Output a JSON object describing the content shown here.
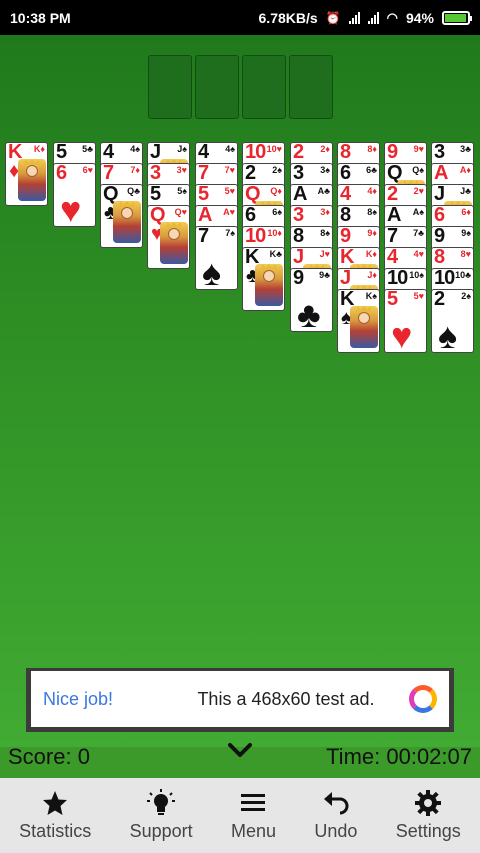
{
  "status_bar": {
    "time": "10:38 PM",
    "network_speed": "6.78KB/s",
    "battery_percent": "94%",
    "battery_level": 0.94,
    "icons": [
      "alarm-off-icon",
      "signal-icon",
      "signal-icon",
      "wifi-icon",
      "battery-charging-icon"
    ]
  },
  "colors": {
    "felt_top": "#207a1c",
    "felt_bottom": "#41ab33",
    "red_suit": "#e8262d",
    "black_suit": "#111111",
    "nav_bg": "#e6e6e6"
  },
  "foundations": [
    {
      "slot": "foundation-1",
      "card": null
    },
    {
      "slot": "foundation-2",
      "card": null
    },
    {
      "slot": "foundation-3",
      "card": null
    },
    {
      "slot": "foundation-4",
      "card": null
    }
  ],
  "tableau": [
    [
      {
        "rank": "K",
        "suit": "♦"
      }
    ],
    [
      {
        "rank": "5",
        "suit": "♣"
      },
      {
        "rank": "6",
        "suit": "♥"
      }
    ],
    [
      {
        "rank": "4",
        "suit": "♠"
      },
      {
        "rank": "7",
        "suit": "♦"
      },
      {
        "rank": "Q",
        "suit": "♣"
      }
    ],
    [
      {
        "rank": "J",
        "suit": "♠"
      },
      {
        "rank": "3",
        "suit": "♥"
      },
      {
        "rank": "5",
        "suit": "♠"
      },
      {
        "rank": "Q",
        "suit": "♥"
      }
    ],
    [
      {
        "rank": "4",
        "suit": "♠"
      },
      {
        "rank": "7",
        "suit": "♥"
      },
      {
        "rank": "5",
        "suit": "♥"
      },
      {
        "rank": "A",
        "suit": "♥"
      },
      {
        "rank": "7",
        "suit": "♠"
      }
    ],
    [
      {
        "rank": "10",
        "suit": "♥"
      },
      {
        "rank": "2",
        "suit": "♠"
      },
      {
        "rank": "Q",
        "suit": "♦"
      },
      {
        "rank": "6",
        "suit": "♠"
      },
      {
        "rank": "10",
        "suit": "♦"
      },
      {
        "rank": "K",
        "suit": "♣"
      }
    ],
    [
      {
        "rank": "2",
        "suit": "♦"
      },
      {
        "rank": "3",
        "suit": "♠"
      },
      {
        "rank": "A",
        "suit": "♣"
      },
      {
        "rank": "3",
        "suit": "♦"
      },
      {
        "rank": "8",
        "suit": "♠"
      },
      {
        "rank": "J",
        "suit": "♥"
      },
      {
        "rank": "9",
        "suit": "♣"
      }
    ],
    [
      {
        "rank": "8",
        "suit": "♦"
      },
      {
        "rank": "6",
        "suit": "♣"
      },
      {
        "rank": "4",
        "suit": "♦"
      },
      {
        "rank": "8",
        "suit": "♠"
      },
      {
        "rank": "9",
        "suit": "♦"
      },
      {
        "rank": "K",
        "suit": "♦"
      },
      {
        "rank": "J",
        "suit": "♦"
      },
      {
        "rank": "K",
        "suit": "♠"
      }
    ],
    [
      {
        "rank": "9",
        "suit": "♥"
      },
      {
        "rank": "Q",
        "suit": "♠"
      },
      {
        "rank": "2",
        "suit": "♥"
      },
      {
        "rank": "A",
        "suit": "♠"
      },
      {
        "rank": "7",
        "suit": "♣"
      },
      {
        "rank": "4",
        "suit": "♥"
      },
      {
        "rank": "10",
        "suit": "♠"
      },
      {
        "rank": "5",
        "suit": "♥"
      }
    ],
    [
      {
        "rank": "3",
        "suit": "♣"
      },
      {
        "rank": "A",
        "suit": "♦"
      },
      {
        "rank": "J",
        "suit": "♣"
      },
      {
        "rank": "6",
        "suit": "♦"
      },
      {
        "rank": "9",
        "suit": "♠"
      },
      {
        "rank": "8",
        "suit": "♥"
      },
      {
        "rank": "10",
        "suit": "♣"
      },
      {
        "rank": "2",
        "suit": "♠"
      }
    ]
  ],
  "ad": {
    "title": "Nice job!",
    "text": "This a 468x60 test ad.",
    "icon": "ad-choices-icon"
  },
  "score_bar": {
    "score": "Score: 0",
    "time": "Time: 00:02:07",
    "toggle_icon": "chevron-down-icon"
  },
  "bottom_nav": [
    {
      "label": "Statistics",
      "icon": "star-icon"
    },
    {
      "label": "Support",
      "icon": "lightbulb-icon"
    },
    {
      "label": "Menu",
      "icon": "menu-icon"
    },
    {
      "label": "Undo",
      "icon": "undo-icon"
    },
    {
      "label": "Settings",
      "icon": "gear-icon"
    }
  ]
}
